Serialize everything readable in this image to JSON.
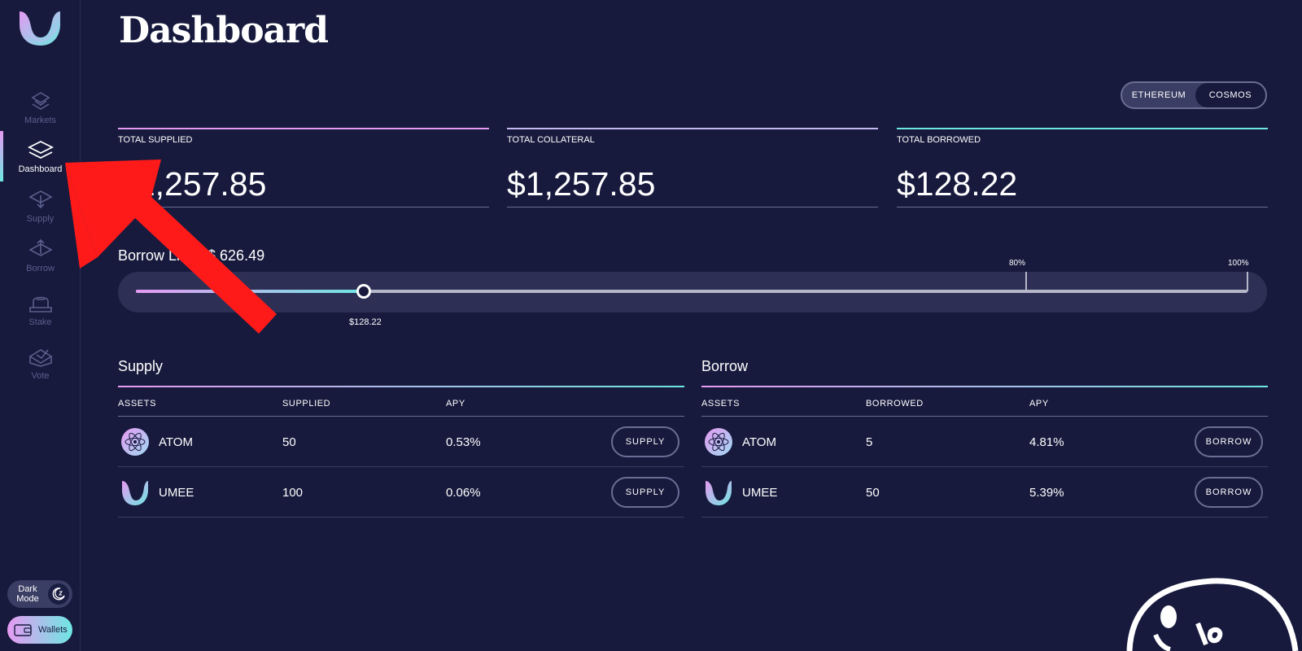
{
  "sidebar": {
    "items": [
      {
        "label": "Markets",
        "icon": "markets-icon"
      },
      {
        "label": "Dashboard",
        "icon": "dashboard-layers-icon"
      },
      {
        "label": "Supply",
        "icon": "supply-icon"
      },
      {
        "label": "Borrow",
        "icon": "borrow-icon"
      },
      {
        "label": "Stake",
        "icon": "stake-icon"
      },
      {
        "label": "Vote",
        "icon": "vote-icon"
      }
    ],
    "active": "Dashboard",
    "dark_mode_label_1": "Dark",
    "dark_mode_label_2": "Mode",
    "wallets_label": "Wallets"
  },
  "header": {
    "title": "Dashboard",
    "network_toggle": {
      "options": [
        "ETHEREUM",
        "COSMOS"
      ],
      "selected": "COSMOS"
    }
  },
  "stats": {
    "total_supplied": {
      "label": "TOTAL SUPPLIED",
      "value": "$1,257.85"
    },
    "total_collateral": {
      "label": "TOTAL COLLATERAL",
      "value": "$1,257.85"
    },
    "total_borrowed": {
      "label": "TOTAL BORROWED",
      "value": "$128.22"
    }
  },
  "borrow_limit": {
    "label": "Borrow Limit: $ 626.49",
    "current_label": "$128.22",
    "current_fraction": 0.205,
    "tick_80_label": "80%",
    "tick_100_label": "100%"
  },
  "supply_table": {
    "title": "Supply",
    "headers": [
      "ASSETS",
      "SUPPLIED",
      "APY"
    ],
    "rows": [
      {
        "asset": "ATOM",
        "amount": "50",
        "apy": "0.53%",
        "action": "SUPPLY"
      },
      {
        "asset": "UMEE",
        "amount": "100",
        "apy": "0.06%",
        "action": "SUPPLY"
      }
    ]
  },
  "borrow_table": {
    "title": "Borrow",
    "headers": [
      "ASSETS",
      "BORROWED",
      "APY"
    ],
    "rows": [
      {
        "asset": "ATOM",
        "amount": "5",
        "apy": "4.81%",
        "action": "BORROW"
      },
      {
        "asset": "UMEE",
        "amount": "50",
        "apy": "5.39%",
        "action": "BORROW"
      }
    ]
  },
  "colors": {
    "background": "#171a3d",
    "accent_pink": "#e69af2",
    "accent_cyan": "#6ee6e2",
    "annotation_arrow": "#ff1a1a"
  }
}
